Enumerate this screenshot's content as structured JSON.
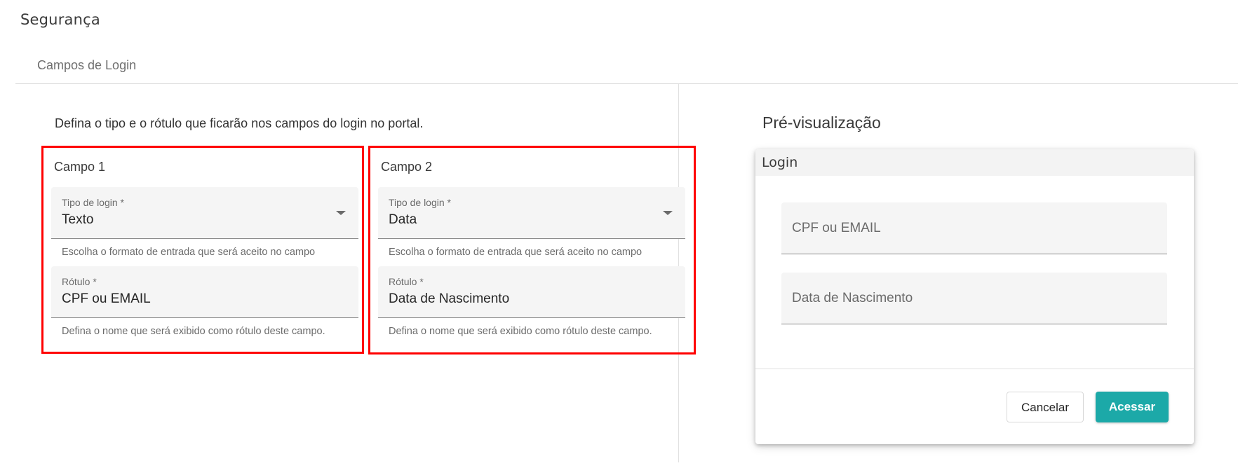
{
  "page": {
    "title": "Segurança",
    "tab": "Campos de Login",
    "instructions": "Defina o tipo e o rótulo que ficarão nos campos do login no portal."
  },
  "fields": [
    {
      "title": "Campo 1",
      "type_label": "Tipo de login *",
      "type_value": "Texto",
      "type_hint": "Escolha o formato de entrada que será aceito no campo",
      "label_label": "Rótulo *",
      "label_value": "CPF ou EMAIL",
      "label_hint": "Defina o nome que será exibido como rótulo deste campo."
    },
    {
      "title": "Campo 2",
      "type_label": "Tipo de login *",
      "type_value": "Data",
      "type_hint": "Escolha o formato de entrada que será aceito no campo",
      "label_label": "Rótulo *",
      "label_value": "Data de Nascimento",
      "label_hint": "Defina o nome que será exibido como rótulo deste campo."
    }
  ],
  "preview": {
    "title": "Pré-visualização",
    "login_title": "Login",
    "field1_label": "CPF ou EMAIL",
    "field2_label": "Data de Nascimento",
    "cancel_label": "Cancelar",
    "access_label": "Acessar"
  },
  "colors": {
    "accent": "#1ca9a8",
    "highlight_border": "#ff0000"
  }
}
